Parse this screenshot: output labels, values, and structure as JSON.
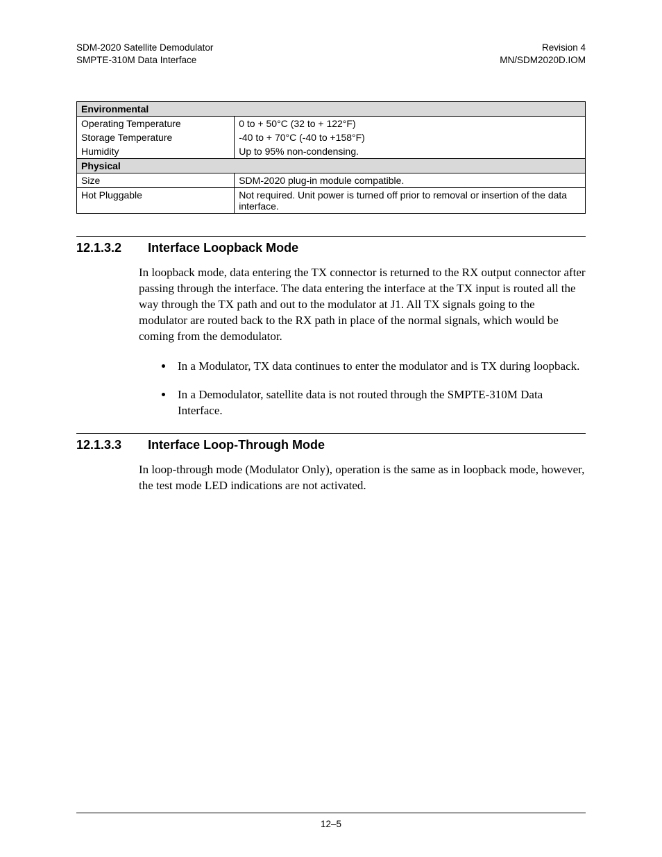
{
  "header": {
    "left1": "SDM-2020 Satellite Demodulator",
    "left2": "SMPTE-310M Data Interface",
    "right1": "Revision 4",
    "right2": "MN/SDM2020D.IOM"
  },
  "table": {
    "env_header": "Environmental",
    "rows_env": [
      {
        "label": "Operating Temperature",
        "value": "0 to + 50°C (32 to + 122°F)"
      },
      {
        "label": "Storage Temperature",
        "value": "-40 to + 70°C (-40 to +158°F)"
      },
      {
        "label": "Humidity",
        "value": "Up to 95% non-condensing."
      }
    ],
    "phys_header": "Physical",
    "rows_phys": [
      {
        "label": "Size",
        "value": "SDM-2020 plug-in module compatible."
      },
      {
        "label": "Hot Pluggable",
        "value": "Not required. Unit power is turned off prior to removal or insertion of the data interface."
      }
    ]
  },
  "s1": {
    "num": "12.1.3.2",
    "title": "Interface Loopback Mode",
    "para": "In loopback mode, data entering the TX connector is returned to the RX output connector after passing through the interface. The data entering the interface at the TX input is routed all the way through the TX path and out to the modulator at J1. All TX signals going to the modulator are routed back to the RX path in place of the normal signals, which would be coming from the demodulator.",
    "bullets": [
      "In a Modulator, TX data continues to enter the modulator and is TX during loopback.",
      "In a Demodulator, satellite data is not routed through the SMPTE-310M Data Interface."
    ]
  },
  "s2": {
    "num": "12.1.3.3",
    "title": "Interface Loop-Through Mode",
    "para": "In loop-through mode (Modulator Only), operation is the same as in loopback mode, however, the test mode LED indications are not activated."
  },
  "page_number": "12–5"
}
